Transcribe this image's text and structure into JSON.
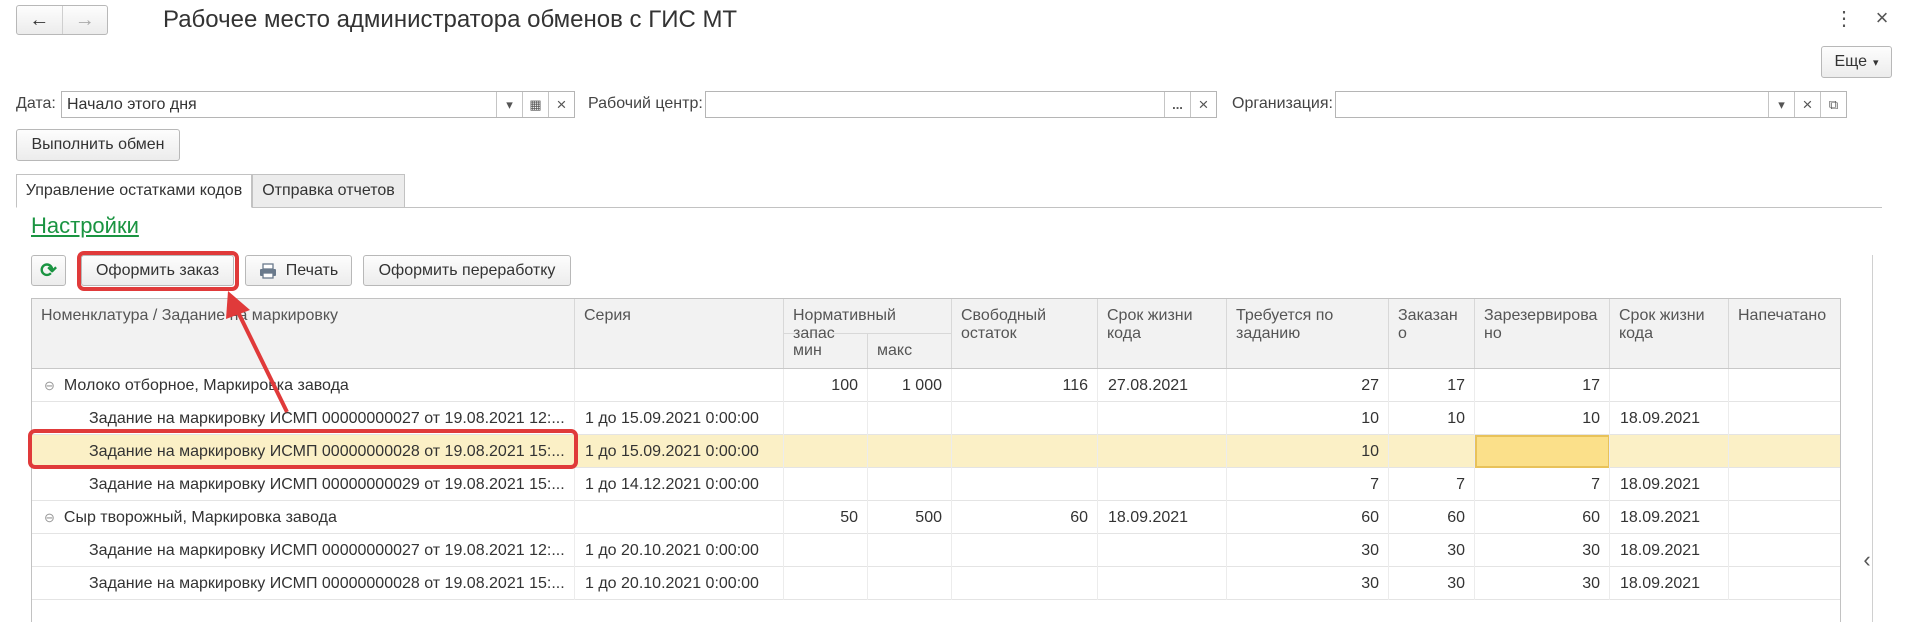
{
  "window": {
    "title": "Рабочее место администратора обменов с ГИС МТ",
    "back_glyph": "←",
    "forward_glyph": "→",
    "kebab_glyph": "⋮",
    "close_glyph": "×",
    "more_label": "Еще",
    "more_glyph": "▾"
  },
  "filters": {
    "date": {
      "label": "Дата:",
      "value": "Начало этого дня"
    },
    "work_center": {
      "label": "Рабочий центр:",
      "value": ""
    },
    "organization": {
      "label": "Организация:",
      "value": ""
    },
    "dropdown_glyph": "▾",
    "clear_glyph": "×",
    "select_glyph": "...",
    "calendar_glyph": "▦",
    "open_glyph": "⧉"
  },
  "actions": {
    "run_exchange": "Выполнить обмен"
  },
  "tabs": [
    {
      "label": "Управление остатками кодов",
      "active": true
    },
    {
      "label": "Отправка отчетов",
      "active": false
    }
  ],
  "section_title": "Настройки",
  "toolbar": {
    "refresh_glyph": "⟳",
    "order": "Оформить заказ",
    "print": "Печать",
    "rework": "Оформить переработку"
  },
  "table": {
    "headers": {
      "nomenclature": "Номенклатура / Задание на маркировку",
      "series": "Серия",
      "norm_stock": "Нормативный запас",
      "min": "мин",
      "max": "макс",
      "free_rest": "Свободный остаток",
      "shelf_life": "Срок жизни кода",
      "required": "Требуется по заданию",
      "ordered": "Заказано",
      "reserved": "Зарезервировано",
      "shelf_life2": "Срок жизни кода",
      "printed": "Напечатано"
    },
    "collapse_glyph": "⊖",
    "rows": [
      {
        "group": true,
        "name": "Молоко отборное, Маркировка завода",
        "series": "",
        "min": "100",
        "max": "1 000",
        "free": "116",
        "shelf": "27.08.2021",
        "required": "27",
        "ordered": "17",
        "reserved": "17",
        "shelf2": "",
        "printed": ""
      },
      {
        "group": false,
        "name": "Задание на маркировку ИСМП 00000000027 от 19.08.2021 12:...",
        "series": "1 до 15.09.2021 0:00:00",
        "min": "",
        "max": "",
        "free": "",
        "shelf": "",
        "required": "10",
        "ordered": "10",
        "reserved": "10",
        "shelf2": "18.09.2021",
        "printed": ""
      },
      {
        "group": false,
        "selected": true,
        "name": "Задание на маркировку ИСМП 00000000028 от 19.08.2021 15:...",
        "series": "1 до 15.09.2021 0:00:00",
        "min": "",
        "max": "",
        "free": "",
        "shelf": "",
        "required": "10",
        "ordered": "",
        "reserved": "",
        "shelf2": "",
        "printed": ""
      },
      {
        "group": false,
        "name": "Задание на маркировку ИСМП 00000000029 от 19.08.2021 15:...",
        "series": "1 до 14.12.2021 0:00:00",
        "min": "",
        "max": "",
        "free": "",
        "shelf": "",
        "required": "7",
        "ordered": "7",
        "reserved": "7",
        "shelf2": "18.09.2021",
        "printed": ""
      },
      {
        "group": true,
        "name": "Сыр творожный, Маркировка завода",
        "series": "",
        "min": "50",
        "max": "500",
        "free": "60",
        "shelf": "18.09.2021",
        "required": "60",
        "ordered": "60",
        "reserved": "60",
        "shelf2": "18.09.2021",
        "printed": ""
      },
      {
        "group": false,
        "name": "Задание на маркировку ИСМП 00000000027 от 19.08.2021 12:...",
        "series": "1 до 20.10.2021 0:00:00",
        "min": "",
        "max": "",
        "free": "",
        "shelf": "",
        "required": "30",
        "ordered": "30",
        "reserved": "30",
        "shelf2": "18.09.2021",
        "printed": ""
      },
      {
        "group": false,
        "name": "Задание на маркировку ИСМП 00000000028 от 19.08.2021 15:...",
        "series": "1 до 20.10.2021 0:00:00",
        "min": "",
        "max": "",
        "free": "",
        "shelf": "",
        "required": "30",
        "ordered": "30",
        "reserved": "30",
        "shelf2": "18.09.2021",
        "printed": ""
      }
    ]
  },
  "panel_collapse_glyph": "‹",
  "colors": {
    "accent_green": "#1a9441",
    "highlight_red": "#e03a3a",
    "selected_row": "#fbf0c6",
    "selected_cell": "#fbe08a"
  }
}
